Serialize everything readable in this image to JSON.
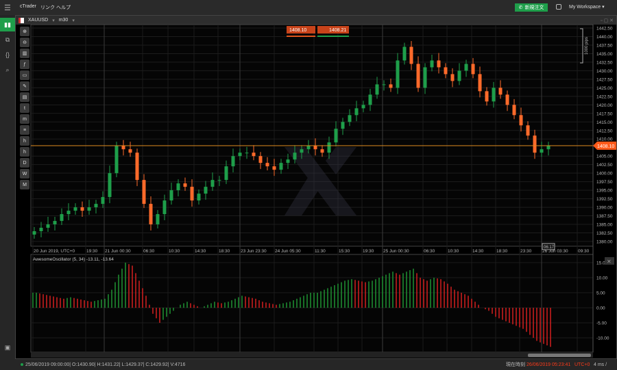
{
  "topbar": {
    "menu": [
      "cTrader",
      "リンク",
      "ヘルプ"
    ],
    "new_order": "新規注文",
    "workspace": "My Workspace"
  },
  "chart_header": {
    "symbol": "XAUUSD",
    "timeframe": "m30"
  },
  "quote": {
    "bid": "1408.10",
    "ask": "1408.21"
  },
  "tools": [
    "D",
    "W",
    "M"
  ],
  "price_axis": {
    "labels": [
      "1442.50",
      "1440.00",
      "1437.50",
      "1435.00",
      "1432.50",
      "1430.00",
      "1427.50",
      "1425.00",
      "1422.50",
      "1420.00",
      "1417.50",
      "1415.00",
      "1412.50",
      "1410.00",
      "1405.00",
      "1402.50",
      "1400.00",
      "1397.50",
      "1395.00",
      "1392.50",
      "1390.00",
      "1387.50",
      "1385.00",
      "1382.50",
      "1380.00"
    ],
    "current": "1408.10",
    "pips": "1000 pips",
    "countdown": "06:17"
  },
  "time_axis": [
    "20 Jun 2019, UTC+0",
    "19:30",
    "21 Jun 00:30",
    "06:30",
    "10:30",
    "14:30",
    "18:30",
    "23 Jun 23:30",
    "24 Jun 05:30",
    "11:30",
    "15:30",
    "19:30",
    "25 Jun 00:30",
    "06:30",
    "10:30",
    "14:30",
    "18:30",
    "23:30",
    "26 Jun 03:30",
    "09:30"
  ],
  "oscillator": {
    "title": "AwesomeOscillator (5, 34) -13.11, -13.64",
    "labels": [
      "15.00",
      "10.00",
      "5.00",
      "0.00",
      "-5.00",
      "-10.00"
    ]
  },
  "status": {
    "bar": "25/06/2019 09:00:00| O:1430.90| H:1431.22| L:1429.37| C:1429.92| V:4716",
    "time_label": "現在時刻",
    "time": "26/06/2019 05:23:41",
    "tz": "UTC+0",
    "latency": "4 ms /"
  },
  "colors": {
    "up": "#1e9e4a",
    "down": "#ff6a2a",
    "accent": "#1e9e4a",
    "price_line": "#e08a1e"
  },
  "chart_data": {
    "type": "candlestick",
    "symbol": "XAUUSD",
    "ylim": [
      1380,
      1442.5
    ],
    "closes": [
      1383,
      1384,
      1385,
      1386,
      1388,
      1389,
      1390,
      1389,
      1390,
      1391,
      1393,
      1400,
      1408,
      1407,
      1406,
      1398,
      1391,
      1385,
      1388,
      1392,
      1395,
      1397,
      1396,
      1392,
      1394,
      1396,
      1398,
      1398,
      1402,
      1405,
      1406,
      1406,
      1405,
      1403,
      1402,
      1401,
      1403,
      1404,
      1406,
      1407,
      1408,
      1407,
      1406,
      1409,
      1413,
      1415,
      1417,
      1419,
      1420,
      1423,
      1426,
      1426,
      1425,
      1433,
      1437,
      1432,
      1425,
      1431,
      1433,
      1431,
      1429,
      1427,
      1430,
      1432,
      1429,
      1424,
      1421,
      1425,
      1423,
      1420,
      1417,
      1414,
      1411,
      1406,
      1407,
      1408
    ],
    "ao": [
      5,
      4.5,
      4,
      3.5,
      3,
      3.5,
      3,
      2.5,
      2,
      2.5,
      3,
      6,
      11,
      15,
      14,
      9,
      4,
      -2,
      -5,
      -3,
      -1,
      1,
      2,
      1,
      0,
      1,
      2,
      1.5,
      2,
      3,
      4,
      3.5,
      3,
      2,
      1.5,
      1,
      1.5,
      2,
      3,
      4,
      5,
      5,
      6,
      7,
      8,
      9,
      9.5,
      9,
      8.5,
      9,
      10,
      11,
      12,
      11,
      12,
      13,
      10,
      9,
      10,
      9.5,
      8,
      6,
      5,
      4,
      2,
      0,
      -1,
      -3,
      -4,
      -5,
      -6,
      -7,
      -9,
      -11,
      -12,
      -13
    ],
    "ao_ylim": [
      -15,
      17
    ]
  }
}
